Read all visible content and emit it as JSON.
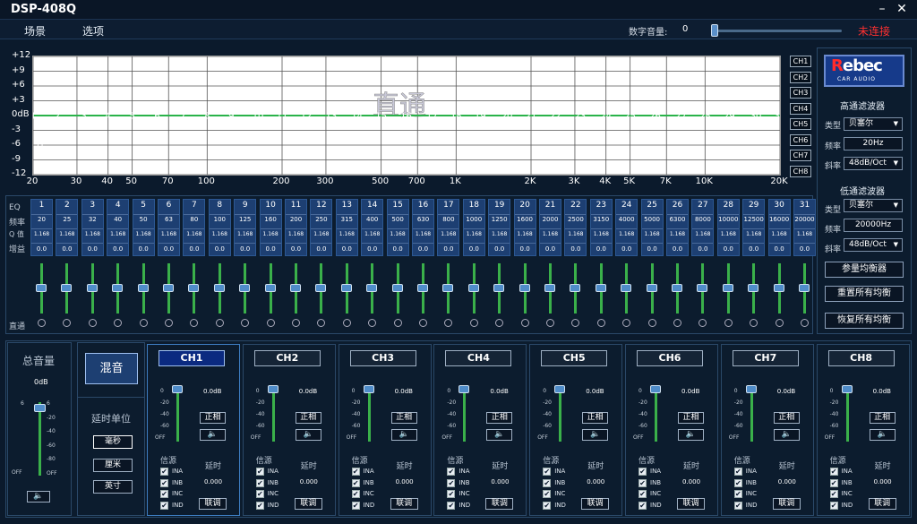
{
  "title": "DSP-408Q",
  "window": {
    "minimize": "–",
    "close": "✕"
  },
  "menu": [
    "场景",
    "选项"
  ],
  "digital_volume": {
    "label": "数字音量:",
    "value": "0",
    "level_fraction": 0.0
  },
  "connection_status": "未连接",
  "colors": {
    "background": "#0b1a2c",
    "panel": "#0c1c2e",
    "band_cell": "#1d3f72",
    "curve": "#2ab34a",
    "disconnected": "#ff3030"
  },
  "eq_graph": {
    "overlay_text": "直通",
    "y_ticks": [
      "+12",
      "+9",
      "+6",
      "+3",
      "0dB",
      "-3",
      "-6",
      "-9",
      "-12"
    ],
    "y_values": [
      12,
      9,
      6,
      3,
      0,
      -3,
      -6,
      -9,
      -12
    ],
    "x_ticks": [
      "20",
      "30",
      "40",
      "50",
      "70",
      "100",
      "200",
      "300",
      "500",
      "700",
      "1K",
      "2K",
      "3K",
      "4K",
      "5K",
      "7K",
      "10K",
      "20K"
    ],
    "x_values": [
      20,
      30,
      40,
      50,
      70,
      100,
      200,
      300,
      500,
      700,
      1000,
      2000,
      3000,
      4000,
      5000,
      7000,
      10000,
      20000
    ],
    "hp_marker": "H",
    "lp_marker": "L",
    "curve_gain_db": 0
  },
  "chart_data": {
    "type": "line",
    "title": "",
    "xlabel": "",
    "ylabel": "",
    "x_scale": "log",
    "xlim": [
      20,
      20000
    ],
    "ylim": [
      -12,
      12
    ],
    "grid": true,
    "series": [
      {
        "x": [
          20,
          25,
          32,
          40,
          50,
          63,
          80,
          100,
          125,
          160,
          200,
          250,
          315,
          400,
          500,
          630,
          800,
          1000,
          1250,
          1600,
          2000,
          2500,
          3150,
          4000,
          5000,
          6300,
          8000,
          10000,
          12500,
          16000,
          20000
        ],
        "y": [
          0,
          0,
          0,
          0,
          0,
          0,
          0,
          0,
          0,
          0,
          0,
          0,
          0,
          0,
          0,
          0,
          0,
          0,
          0,
          0,
          0,
          0,
          0,
          0,
          0,
          0,
          0,
          0,
          0,
          0,
          0
        ],
        "point_labels": [
          "1",
          "2",
          "3",
          "4",
          "5",
          "6",
          "7",
          "8",
          "9",
          "10",
          "11",
          "12",
          "13",
          "14",
          "15",
          "16",
          "17",
          "18",
          "19",
          "20",
          "21",
          "22",
          "23",
          "24",
          "25",
          "26",
          "27",
          "28",
          "29",
          "30",
          "31"
        ]
      }
    ]
  },
  "channel_selector": [
    "CH1",
    "CH2",
    "CH3",
    "CH4",
    "CH5",
    "CH6",
    "CH7",
    "CH8"
  ],
  "logo": {
    "brand": "Rebec",
    "tagline": "CAR AUDIO"
  },
  "highpass": {
    "title": "高通滤波器",
    "type_label": "类型",
    "type_value": "贝塞尔",
    "freq_label": "频率",
    "freq_value": "20Hz",
    "slope_label": "斜率",
    "slope_value": "48dB/Oct"
  },
  "lowpass": {
    "title": "低通滤波器",
    "type_label": "类型",
    "type_value": "贝塞尔",
    "freq_label": "频率",
    "freq_value": "20000Hz",
    "slope_label": "斜率",
    "slope_value": "48dB/Oct"
  },
  "eq_buttons": [
    "参量均衡器",
    "重置所有均衡",
    "恢复所有均衡"
  ],
  "eq_table": {
    "row_labels": [
      "EQ",
      "频率",
      "Q 值",
      "增益"
    ],
    "bypass_label": "直通",
    "bands": [
      "1",
      "2",
      "3",
      "4",
      "5",
      "6",
      "7",
      "8",
      "9",
      "10",
      "11",
      "12",
      "13",
      "14",
      "15",
      "16",
      "17",
      "18",
      "19",
      "20",
      "21",
      "22",
      "23",
      "24",
      "25",
      "26",
      "27",
      "28",
      "29",
      "30",
      "31"
    ],
    "freqs": [
      "20",
      "25",
      "32",
      "40",
      "50",
      "63",
      "80",
      "100",
      "125",
      "160",
      "200",
      "250",
      "315",
      "400",
      "500",
      "630",
      "800",
      "1000",
      "1250",
      "1600",
      "2000",
      "2500",
      "3150",
      "4000",
      "5000",
      "6300",
      "8000",
      "10000",
      "12500",
      "16000",
      "20000"
    ],
    "q": [
      "1.168",
      "1.168",
      "1.168",
      "1.168",
      "1.168",
      "1.168",
      "1.168",
      "1.168",
      "1.168",
      "1.168",
      "1.168",
      "1.168",
      "1.168",
      "1.168",
      "1.168",
      "1.168",
      "1.168",
      "1.168",
      "1.168",
      "1.168",
      "1.168",
      "1.168",
      "1.168",
      "1.168",
      "1.168",
      "1.168",
      "1.168",
      "1.168",
      "1.168",
      "1.168",
      "1.168"
    ],
    "gain": [
      "0.0",
      "0.0",
      "0.0",
      "0.0",
      "0.0",
      "0.0",
      "0.0",
      "0.0",
      "0.0",
      "0.0",
      "0.0",
      "0.0",
      "0.0",
      "0.0",
      "0.0",
      "0.0",
      "0.0",
      "0.0",
      "0.0",
      "0.0",
      "0.0",
      "0.0",
      "0.0",
      "0.0",
      "0.0",
      "0.0",
      "0.0",
      "0.0",
      "0.0",
      "0.0",
      "0.0"
    ]
  },
  "master": {
    "title": "总音量",
    "value": "0dB",
    "ticks_left": [
      "6",
      "-",
      "-",
      "-",
      "-",
      "OFF"
    ],
    "ticks_right": [
      "6",
      "-20",
      "-40",
      "-60",
      "-80",
      "OFF"
    ],
    "mute_icon": "speaker-icon"
  },
  "mix": {
    "button": "混音",
    "delay_title": "延时单位",
    "units": [
      "毫秒",
      "厘米",
      "英寸"
    ],
    "selected_unit": "毫秒"
  },
  "channels": [
    {
      "name": "CH1",
      "gain": "0.0dB",
      "invert": "正相",
      "source_label": "信源",
      "delay_label": "延时",
      "delay": "0.000",
      "inputs": [
        "INA",
        "INB",
        "INC",
        "IND"
      ],
      "link": "联调"
    },
    {
      "name": "CH2",
      "gain": "0.0dB",
      "invert": "正相",
      "source_label": "信源",
      "delay_label": "延时",
      "delay": "0.000",
      "inputs": [
        "INA",
        "INB",
        "INC",
        "IND"
      ],
      "link": "联调"
    },
    {
      "name": "CH3",
      "gain": "0.0dB",
      "invert": "正相",
      "source_label": "信源",
      "delay_label": "延时",
      "delay": "0.000",
      "inputs": [
        "INA",
        "INB",
        "INC",
        "IND"
      ],
      "link": "联调"
    },
    {
      "name": "CH4",
      "gain": "0.0dB",
      "invert": "正相",
      "source_label": "信源",
      "delay_label": "延时",
      "delay": "0.000",
      "inputs": [
        "INA",
        "INB",
        "INC",
        "IND"
      ],
      "link": "联调"
    },
    {
      "name": "CH5",
      "gain": "0.0dB",
      "invert": "正相",
      "source_label": "信源",
      "delay_label": "延时",
      "delay": "0.000",
      "inputs": [
        "INA",
        "INB",
        "INC",
        "IND"
      ],
      "link": "联调"
    },
    {
      "name": "CH6",
      "gain": "0.0dB",
      "invert": "正相",
      "source_label": "信源",
      "delay_label": "延时",
      "delay": "0.000",
      "inputs": [
        "INA",
        "INB",
        "INC",
        "IND"
      ],
      "link": "联调"
    },
    {
      "name": "CH7",
      "gain": "0.0dB",
      "invert": "正相",
      "source_label": "信源",
      "delay_label": "延时",
      "delay": "0.000",
      "inputs": [
        "INA",
        "INB",
        "INC",
        "IND"
      ],
      "link": "联调"
    },
    {
      "name": "CH8",
      "gain": "0.0dB",
      "invert": "正相",
      "source_label": "信源",
      "delay_label": "延时",
      "delay": "0.000",
      "inputs": [
        "INA",
        "INB",
        "INC",
        "IND"
      ],
      "link": "联调"
    }
  ],
  "channel_fader_ticks": [
    "0",
    "-20",
    "-40",
    "-60",
    "OFF"
  ],
  "active_channel": "CH1",
  "check_mark": "✔"
}
